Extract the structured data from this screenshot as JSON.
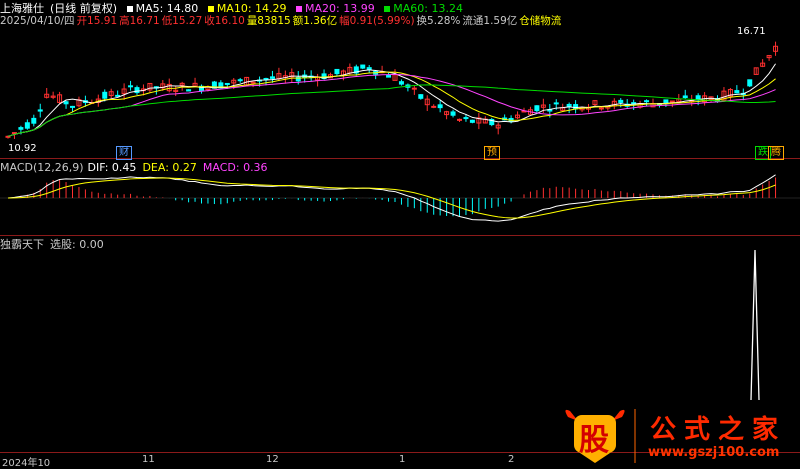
{
  "stock": {
    "name": "上海雅仕",
    "period": "(日线 前复权)"
  },
  "ma": [
    {
      "label": "MA5: 14.80",
      "color": "#ffffff"
    },
    {
      "label": "MA10: 14.29",
      "color": "#ffff00"
    },
    {
      "label": "MA20: 13.99",
      "color": "#ff44ff"
    },
    {
      "label": "MA60: 13.24",
      "color": "#00dd00"
    }
  ],
  "quote": {
    "date": "2025/04/10/四",
    "open": "开15.91",
    "high": "高16.71",
    "low": "低15.27",
    "close": "收16.10",
    "volume": "量83815",
    "amount": "额1.36亿",
    "change": "幅0.91(5.99%)",
    "turnover": "换5.28%",
    "float": "流通1.59亿",
    "sector": "仓储物流"
  },
  "price_labels": {
    "high": "16.71",
    "low": "10.92"
  },
  "event_tags": [
    {
      "text": "财",
      "color": "#5599ff"
    },
    {
      "text": "预",
      "color": "#ffaa00"
    },
    {
      "text": "跌",
      "color": "#00dd00"
    },
    {
      "text": "腾",
      "color": "#ffaa00"
    }
  ],
  "macd": {
    "title": "MACD(12,26,9)",
    "dif": "DIF: 0.45",
    "dea": "DEA: 0.27",
    "macd": "MACD: 0.36"
  },
  "indicator": {
    "title": "独霸天下",
    "value": "选股: 0.00"
  },
  "time_axis": [
    "2024年10",
    "11",
    "12",
    "1",
    "2"
  ],
  "logo": {
    "big": "股",
    "title": "公式之家",
    "url": "www.gszj100.com"
  },
  "colors": {
    "up": "#ff3030",
    "down": "#00ffff",
    "grid": "#8b1a1a",
    "ma5": "#ffffff",
    "ma10": "#ffff00",
    "ma20": "#ff44ff",
    "ma60": "#00dd00"
  }
}
